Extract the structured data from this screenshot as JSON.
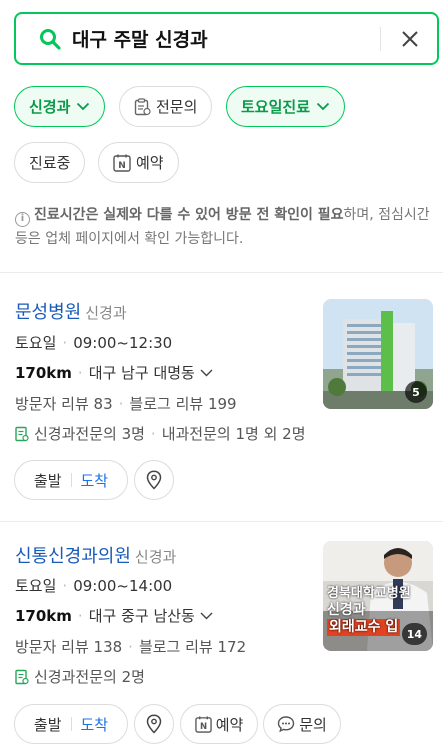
{
  "search": {
    "query": "대구 주말 신경과"
  },
  "filters": {
    "neurology": "신경과",
    "specialist": "전문의",
    "saturday": "토요일진료",
    "open_now": "진료중",
    "reservation": "예약"
  },
  "notice": {
    "bold": "진료시간은 실제와 다를 수 있어 방문 전 확인이 필요",
    "rest": "하며, 점심시간 등은 업체 페이지에서 확인 가능합니다."
  },
  "results": [
    {
      "name": "문성병원",
      "category": "신경과",
      "day": "토요일",
      "hours": "09:00~12:30",
      "distance": "170km",
      "address": "대구 남구 대명동",
      "visitor_review": "방문자 리뷰 83",
      "blog_review": "블로그 리뷰 199",
      "specialists": "신경과전문의 3명",
      "specialists_extra": "내과전문의 1명 외 2명",
      "photo_count": "5"
    },
    {
      "name": "신통신경과의원",
      "category": "신경과",
      "day": "토요일",
      "hours": "09:00~14:00",
      "distance": "170km",
      "address": "대구 중구 남산동",
      "visitor_review": "방문자 리뷰 138",
      "blog_review": "블로그 리뷰 172",
      "specialists": "신경과전문의 2명",
      "photo_count": "14",
      "photo_text": [
        "경북대학교병원",
        "신경과",
        "외래교수 입"
      ]
    }
  ],
  "actions": {
    "depart": "출발",
    "arrive": "도착",
    "reserve": "예약",
    "inquiry": "문의"
  },
  "colors": {
    "accent": "#03c75a",
    "link": "#1a5bb8"
  }
}
